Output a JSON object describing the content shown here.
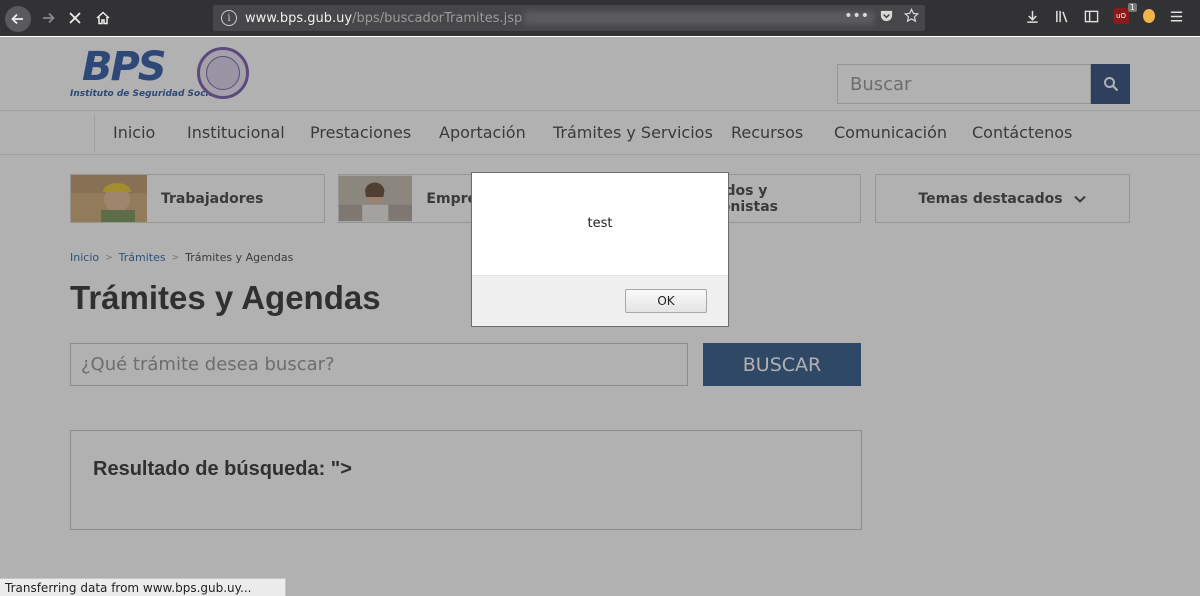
{
  "browser": {
    "url_host": "www.bps.gub.uy",
    "url_path": "/bps/buscadorTramites.jsp"
  },
  "site": {
    "logo_text": "BPS",
    "logo_subtitle": "Instituto de Seguridad Social",
    "search_placeholder": "Buscar",
    "nav": [
      "Inicio",
      "Institucional",
      "Prestaciones",
      "Aportación",
      "Trámites y Servicios",
      "Recursos",
      "Comunicación",
      "Contáctenos"
    ],
    "categories": {
      "trabajadores": "Trabajadores",
      "empresas": "Empre",
      "jubilados_line1": "ados y",
      "jubilados_line2": "ionistas",
      "temas": "Temas destacados"
    }
  },
  "breadcrumb": {
    "home": "Inicio",
    "sep": ">",
    "tramites": "Trámites",
    "current": "Trámites y Agendas"
  },
  "page": {
    "title": "Trámites y Agendas",
    "tramite_placeholder": "¿Qué trámite desea buscar?",
    "buscar_label": "BUSCAR",
    "results_title": "Resultado de búsqueda: \">"
  },
  "dialog": {
    "message": "test",
    "ok_label": "OK"
  },
  "status": {
    "text": "Transferring data from www.bps.gub.uy..."
  },
  "colors": {
    "brand_blue": "#1e4a9c",
    "button_navy": "#1f4b7d"
  }
}
